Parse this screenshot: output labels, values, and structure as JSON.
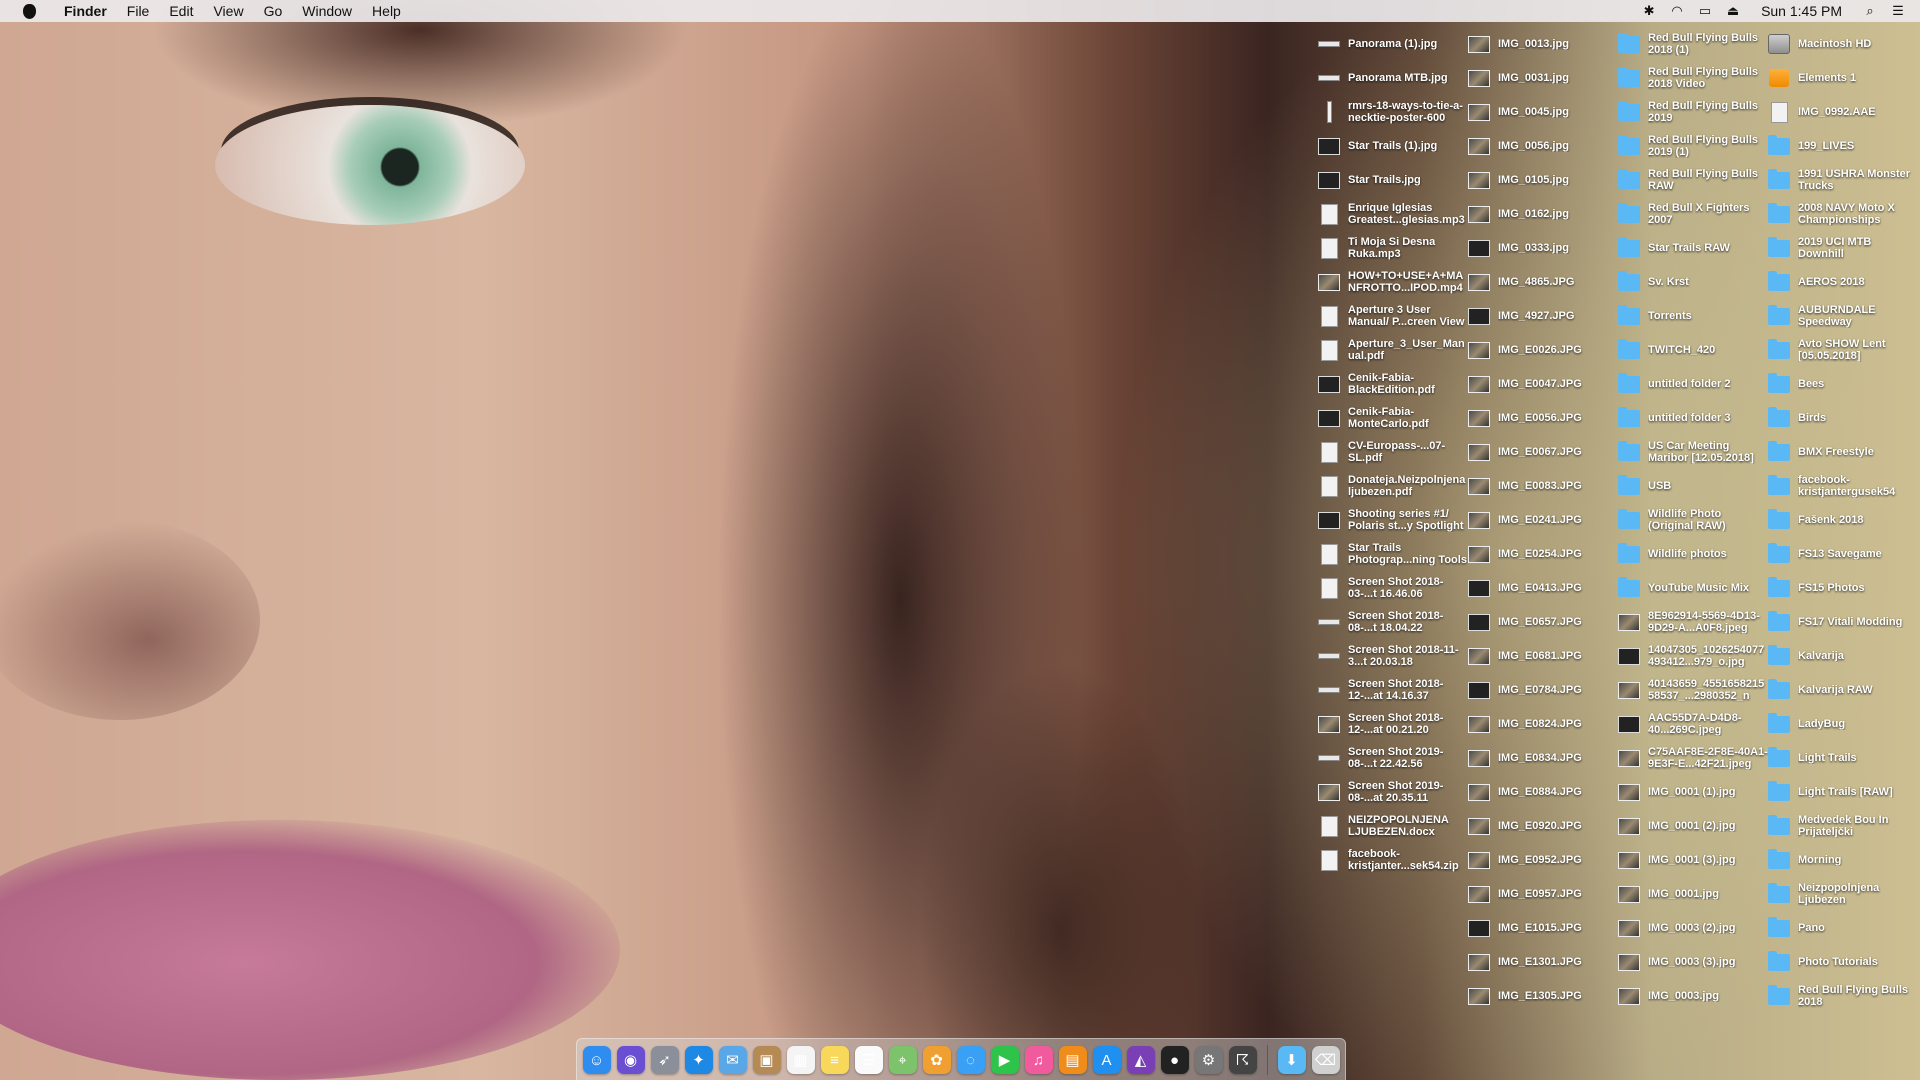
{
  "menubar": {
    "app_name": "Finder",
    "menus": [
      "File",
      "Edit",
      "View",
      "Go",
      "Window",
      "Help"
    ],
    "status_icons": [
      "bluetooth-icon",
      "wifi-icon",
      "airplay-icon",
      "eject-icon"
    ],
    "clock": "Sun 1:45 PM"
  },
  "desktop": {
    "columns": [
      {
        "items": [
          {
            "label": "Panorama (1).jpg",
            "icon": "wide"
          },
          {
            "label": "Panorama MTB.jpg",
            "icon": "wide"
          },
          {
            "label": "rmrs-18-ways-to-tie-a-necktie-poster-600",
            "icon": "thin"
          },
          {
            "label": "Star Trails (1).jpg",
            "icon": "dark"
          },
          {
            "label": "Star Trails.jpg",
            "icon": "dark"
          },
          {
            "label": "Enrique Iglesias Greatest...glesias.mp3",
            "icon": "file"
          },
          {
            "label": "Ti Moja Si Desna Ruka.mp3",
            "icon": "file"
          },
          {
            "label": "HOW+TO+USE+A+MANFROTTO...IPOD.mp4",
            "icon": "photo"
          },
          {
            "label": "Aperture 3 User Manual/ P...creen View",
            "icon": "file"
          },
          {
            "label": "Aperture_3_User_Manual.pdf",
            "icon": "file"
          },
          {
            "label": "Cenik-Fabia-BlackEdition.pdf",
            "icon": "dark"
          },
          {
            "label": "Cenik-Fabia-MonteCarlo.pdf",
            "icon": "dark"
          },
          {
            "label": "CV-Europass-...07-SL.pdf",
            "icon": "file"
          },
          {
            "label": "Donateja.Neizpolnjenaljubezen.pdf",
            "icon": "file"
          },
          {
            "label": "Shooting series #1/ Polaris st...y Spotlight",
            "icon": "dark"
          },
          {
            "label": "Star Trails Photograp...ning Tools",
            "icon": "file"
          },
          {
            "label": "Screen Shot 2018-03-...t 16.46.06",
            "icon": "file"
          },
          {
            "label": "Screen Shot 2018-08-...t 18.04.22",
            "icon": "wide"
          },
          {
            "label": "Screen Shot 2018-11-3...t 20.03.18",
            "icon": "wide"
          },
          {
            "label": "Screen Shot 2018-12-...at 14.16.37",
            "icon": "wide"
          },
          {
            "label": "Screen Shot 2018-12-...at 00.21.20",
            "icon": "photo"
          },
          {
            "label": "Screen Shot 2019-08-...t 22.42.56",
            "icon": "wide"
          },
          {
            "label": "Screen Shot 2019-08-...at 20.35.11",
            "icon": "photo"
          },
          {
            "label": "NEIZPOPOLNJENA LJUBEZEN.docx",
            "icon": "file"
          },
          {
            "label": "facebook-kristjanter...sek54.zip",
            "icon": "file"
          }
        ]
      },
      {
        "items": [
          {
            "label": "IMG_0013.jpg",
            "icon": "photo"
          },
          {
            "label": "IMG_0031.jpg",
            "icon": "photo"
          },
          {
            "label": "IMG_0045.jpg",
            "icon": "photo"
          },
          {
            "label": "IMG_0056.jpg",
            "icon": "photo"
          },
          {
            "label": "IMG_0105.jpg",
            "icon": "photo"
          },
          {
            "label": "IMG_0162.jpg",
            "icon": "photo"
          },
          {
            "label": "IMG_0333.jpg",
            "icon": "dark"
          },
          {
            "label": "IMG_4865.JPG",
            "icon": "photo"
          },
          {
            "label": "IMG_4927.JPG",
            "icon": "dark"
          },
          {
            "label": "IMG_E0026.JPG",
            "icon": "photo"
          },
          {
            "label": "IMG_E0047.JPG",
            "icon": "photo"
          },
          {
            "label": "IMG_E0056.JPG",
            "icon": "photo"
          },
          {
            "label": "IMG_E0067.JPG",
            "icon": "photo"
          },
          {
            "label": "IMG_E0083.JPG",
            "icon": "photo"
          },
          {
            "label": "IMG_E0241.JPG",
            "icon": "photo"
          },
          {
            "label": "IMG_E0254.JPG",
            "icon": "photo"
          },
          {
            "label": "IMG_E0413.JPG",
            "icon": "dark"
          },
          {
            "label": "IMG_E0657.JPG",
            "icon": "dark"
          },
          {
            "label": "IMG_E0681.JPG",
            "icon": "photo"
          },
          {
            "label": "IMG_E0784.JPG",
            "icon": "dark"
          },
          {
            "label": "IMG_E0824.JPG",
            "icon": "photo"
          },
          {
            "label": "IMG_E0834.JPG",
            "icon": "photo"
          },
          {
            "label": "IMG_E0884.JPG",
            "icon": "photo"
          },
          {
            "label": "IMG_E0920.JPG",
            "icon": "photo"
          },
          {
            "label": "IMG_E0952.JPG",
            "icon": "photo"
          },
          {
            "label": "IMG_E0957.JPG",
            "icon": "photo"
          },
          {
            "label": "IMG_E1015.JPG",
            "icon": "dark"
          },
          {
            "label": "IMG_E1301.JPG",
            "icon": "photo"
          },
          {
            "label": "IMG_E1305.JPG",
            "icon": "photo"
          }
        ]
      },
      {
        "items": [
          {
            "label": "Red Bull Flying Bulls 2018 (1)",
            "icon": "folder"
          },
          {
            "label": "Red Bull Flying Bulls 2018 Video",
            "icon": "folder"
          },
          {
            "label": "Red Bull Flying Bulls 2019",
            "icon": "folder"
          },
          {
            "label": "Red Bull Flying Bulls 2019 (1)",
            "icon": "folder"
          },
          {
            "label": "Red Bull Flying Bulls RAW",
            "icon": "folder"
          },
          {
            "label": "Red Bull X Fighters 2007",
            "icon": "folder"
          },
          {
            "label": "Star Trails RAW",
            "icon": "folder"
          },
          {
            "label": "Sv. Krst",
            "icon": "folder"
          },
          {
            "label": "Torrents",
            "icon": "folder"
          },
          {
            "label": "TWITCH_420",
            "icon": "folder"
          },
          {
            "label": "untitled folder 2",
            "icon": "folder"
          },
          {
            "label": "untitled folder 3",
            "icon": "folder"
          },
          {
            "label": "US Car Meeting Maribor [12.05.2018]",
            "icon": "folder"
          },
          {
            "label": "USB",
            "icon": "folder"
          },
          {
            "label": "Wildlife Photo (Original RAW)",
            "icon": "folder"
          },
          {
            "label": "Wildlife photos",
            "icon": "folder"
          },
          {
            "label": "YouTube Music Mix",
            "icon": "folder"
          },
          {
            "label": "8E962914-5569-4D13-9D29-A...A0F8.jpeg",
            "icon": "photo"
          },
          {
            "label": "14047305_1026254077493412...979_o.jpg",
            "icon": "dark"
          },
          {
            "label": "40143659_455165821558537_...2980352_n",
            "icon": "photo"
          },
          {
            "label": "AAC55D7A-D4D8-40...269C.jpeg",
            "icon": "dark"
          },
          {
            "label": "C75AAF8E-2F8E-40A1-9E3F-E...42F21.jpeg",
            "icon": "photo"
          },
          {
            "label": "IMG_0001 (1).jpg",
            "icon": "photo"
          },
          {
            "label": "IMG_0001 (2).jpg",
            "icon": "photo"
          },
          {
            "label": "IMG_0001 (3).jpg",
            "icon": "photo"
          },
          {
            "label": "IMG_0001.jpg",
            "icon": "photo"
          },
          {
            "label": "IMG_0003 (2).jpg",
            "icon": "photo"
          },
          {
            "label": "IMG_0003 (3).jpg",
            "icon": "photo"
          },
          {
            "label": "IMG_0003.jpg",
            "icon": "photo"
          }
        ]
      },
      {
        "items": [
          {
            "label": "Macintosh HD",
            "icon": "drive"
          },
          {
            "label": "Elements 1",
            "icon": "orange"
          },
          {
            "label": "IMG_0992.AAE",
            "icon": "file"
          },
          {
            "label": "199_LIVES",
            "icon": "folder"
          },
          {
            "label": "1991 USHRA Monster Trucks",
            "icon": "folder"
          },
          {
            "label": "2008 NAVY Moto X Championships",
            "icon": "folder"
          },
          {
            "label": "2019 UCI MTB Downhill",
            "icon": "folder"
          },
          {
            "label": "AEROS 2018",
            "icon": "folder"
          },
          {
            "label": "AUBURNDALE Speedway",
            "icon": "folder"
          },
          {
            "label": "Avto SHOW Lent [05.05.2018]",
            "icon": "folder"
          },
          {
            "label": "Bees",
            "icon": "folder"
          },
          {
            "label": "Birds",
            "icon": "folder"
          },
          {
            "label": "BMX Freestyle",
            "icon": "folder"
          },
          {
            "label": "facebook-kristjantergusek54",
            "icon": "folder"
          },
          {
            "label": "Fašenk 2018",
            "icon": "folder"
          },
          {
            "label": "FS13 Savegame",
            "icon": "folder"
          },
          {
            "label": "FS15 Photos",
            "icon": "folder"
          },
          {
            "label": "FS17 Vitali Modding",
            "icon": "folder"
          },
          {
            "label": "Kalvarija",
            "icon": "folder"
          },
          {
            "label": "Kalvarija RAW",
            "icon": "folder"
          },
          {
            "label": "LadyBug",
            "icon": "folder"
          },
          {
            "label": "Light Trails",
            "icon": "folder"
          },
          {
            "label": "Light Trails [RAW]",
            "icon": "folder"
          },
          {
            "label": "Medvedek Bou In Prijateljčki",
            "icon": "folder"
          },
          {
            "label": "Morning",
            "icon": "folder"
          },
          {
            "label": "Neizpopolnjena Ljubezen",
            "icon": "folder"
          },
          {
            "label": "Pano",
            "icon": "folder"
          },
          {
            "label": "Photo Tutorials",
            "icon": "folder"
          },
          {
            "label": "Red Bull Flying Bulls 2018",
            "icon": "folder"
          }
        ]
      }
    ]
  },
  "dock": {
    "apps": [
      {
        "name": "finder-icon",
        "color": "#2f8df0",
        "glyph": "☺"
      },
      {
        "name": "siri-icon",
        "color": "#6a4fd3",
        "glyph": "◉"
      },
      {
        "name": "launchpad-icon",
        "color": "#8a8f99",
        "glyph": "➶"
      },
      {
        "name": "safari-icon",
        "color": "#1e88e5",
        "glyph": "✦"
      },
      {
        "name": "mail-icon",
        "color": "#5aa7e8",
        "glyph": "✉"
      },
      {
        "name": "contacts-icon",
        "color": "#b58a55",
        "glyph": "▣"
      },
      {
        "name": "calendar-icon",
        "color": "#f4f4f4",
        "glyph": "▦"
      },
      {
        "name": "notes-icon",
        "color": "#f7d85a",
        "glyph": "≡"
      },
      {
        "name": "reminders-icon",
        "color": "#fafafa",
        "glyph": "☰"
      },
      {
        "name": "maps-icon",
        "color": "#7cc36b",
        "glyph": "⌖"
      },
      {
        "name": "photos-icon",
        "color": "#f0a030",
        "glyph": "✿"
      },
      {
        "name": "messages-icon",
        "color": "#3aa0f5",
        "glyph": "◌"
      },
      {
        "name": "facetime-icon",
        "color": "#2ec34a",
        "glyph": "▶"
      },
      {
        "name": "itunes-icon",
        "color": "#f25a9e",
        "glyph": "♫"
      },
      {
        "name": "books-icon",
        "color": "#f08c1a",
        "glyph": "▤"
      },
      {
        "name": "app-store-icon",
        "color": "#1f8ff0",
        "glyph": "A"
      },
      {
        "name": "affinity-photo-icon",
        "color": "#7a3fb5",
        "glyph": "◭"
      },
      {
        "name": "photo-booth-icon",
        "color": "#222222",
        "glyph": "●"
      },
      {
        "name": "system-preferences-icon",
        "color": "#777777",
        "glyph": "⚙"
      },
      {
        "name": "activity-monitor-icon",
        "color": "#444444",
        "glyph": "☈"
      }
    ],
    "trailing": [
      {
        "name": "downloads-folder-icon",
        "color": "#5ab8f5",
        "glyph": "⬇"
      },
      {
        "name": "trash-icon",
        "color": "#d0d0d0",
        "glyph": "⌫"
      }
    ]
  }
}
